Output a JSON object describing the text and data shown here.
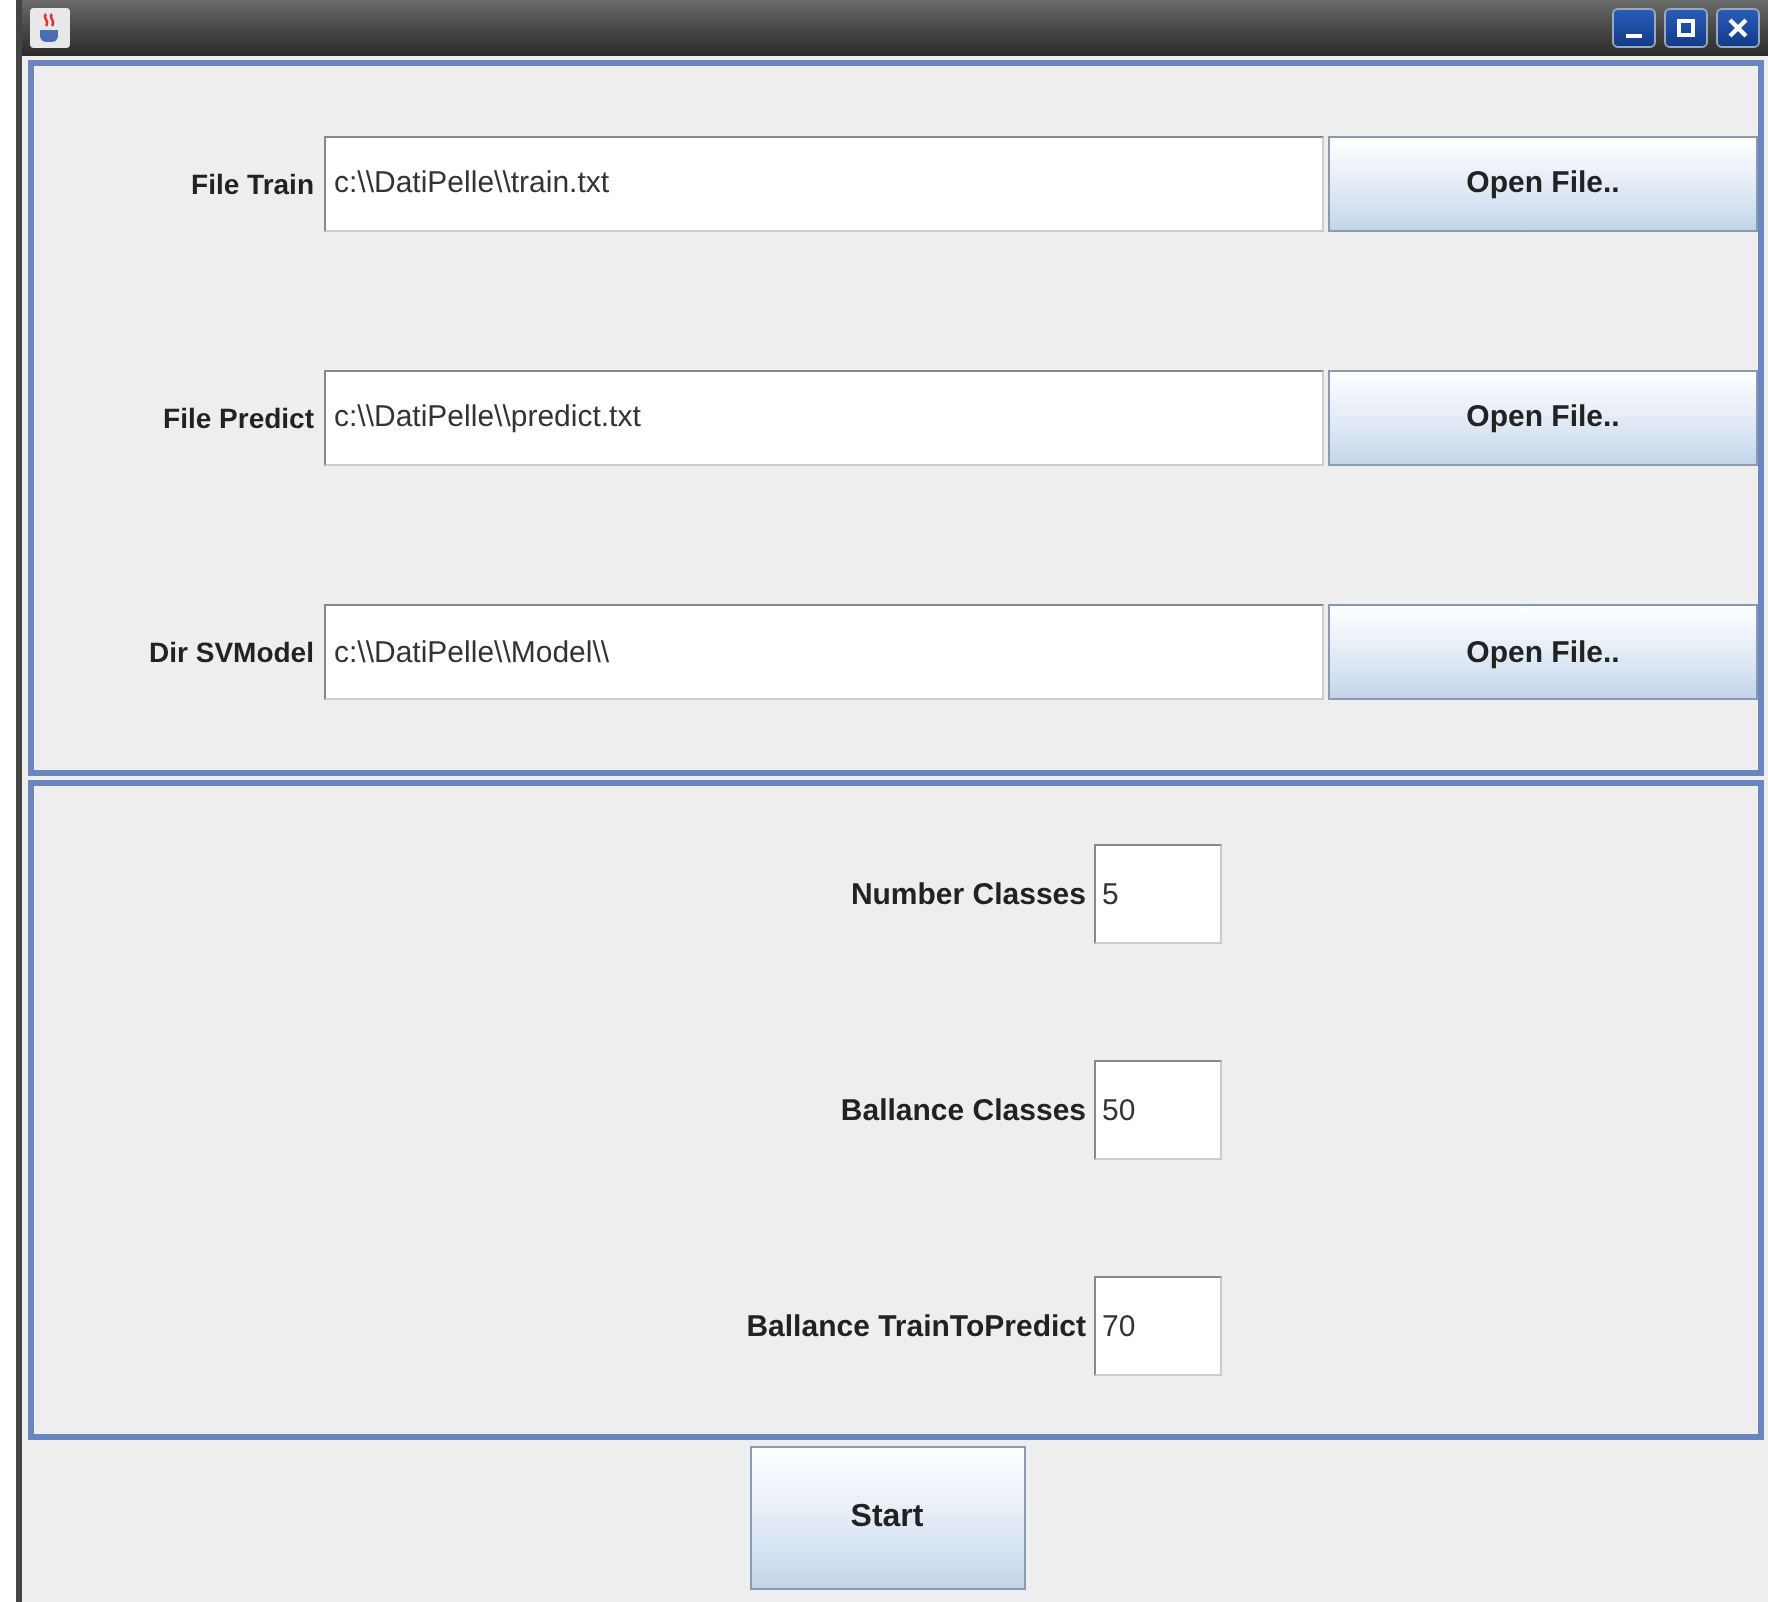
{
  "files": [
    {
      "label": "File Train",
      "value": "c:\\\\DatiPelle\\\\train.txt",
      "button": "Open File.."
    },
    {
      "label": "File Predict",
      "value": "c:\\\\DatiPelle\\\\predict.txt",
      "button": "Open File.."
    },
    {
      "label": "Dir SVModel",
      "value": "c:\\\\DatiPelle\\\\Model\\\\",
      "button": "Open File.."
    }
  ],
  "params": [
    {
      "label": "Number Classes",
      "value": "5"
    },
    {
      "label": "Ballance Classes",
      "value": "50"
    },
    {
      "label": "Ballance TrainToPredict",
      "value": "70"
    }
  ],
  "start_button": "Start"
}
